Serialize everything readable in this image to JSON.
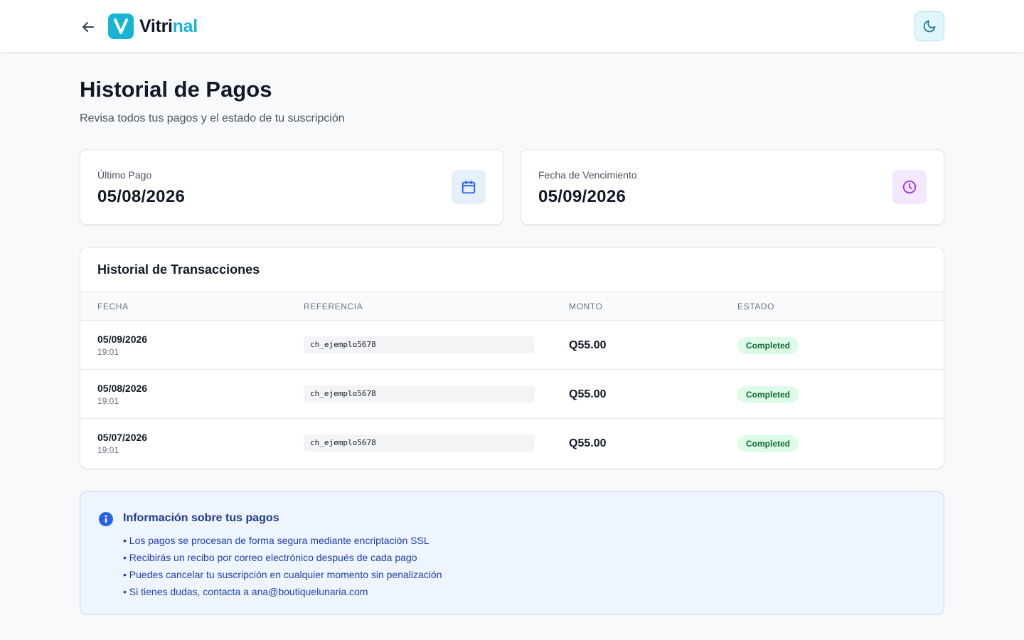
{
  "header": {
    "logo_part1": "Vitri",
    "logo_part2": "nal",
    "brand_color": "#17b4d6",
    "back_icon": "arrow-left-icon",
    "theme_icon": "moon-icon"
  },
  "page": {
    "title": "Historial de Pagos",
    "subtitle": "Revisa todos tus pagos y el estado de tu suscripción"
  },
  "cards": [
    {
      "label": "Último Pago",
      "value": "05/08/2026",
      "icon": "calendar-icon",
      "icon_color": "#2563eb"
    },
    {
      "label": "Fecha de Vencimiento",
      "value": "05/09/2026",
      "icon": "clock-icon",
      "icon_color": "#9333ea"
    }
  ],
  "transactions": {
    "title": "Historial de Transacciones",
    "columns": [
      "FECHA",
      "REFERENCIA",
      "MONTO",
      "ESTADO"
    ],
    "rows": [
      {
        "date": "05/09/2026",
        "time": "19:01",
        "reference": "ch_ejemplo5678",
        "amount": "Q55.00",
        "status": "Completed"
      },
      {
        "date": "05/08/2026",
        "time": "19:01",
        "reference": "ch_ejemplo5678",
        "amount": "Q55.00",
        "status": "Completed"
      },
      {
        "date": "05/07/2026",
        "time": "19:01",
        "reference": "ch_ejemplo5678",
        "amount": "Q55.00",
        "status": "Completed"
      }
    ]
  },
  "info": {
    "title": "Información sobre tus pagos",
    "icon": "info-icon",
    "items": [
      "• Los pagos se procesan de forma segura mediante encriptación SSL",
      "• Recibirás un recibo por correo electrónico después de cada pago",
      "• Puedes cancelar tu suscripción en cualquier momento sin penalización",
      "• Si tienes dudas, contacta a ana@boutiquelunaria.com"
    ]
  }
}
